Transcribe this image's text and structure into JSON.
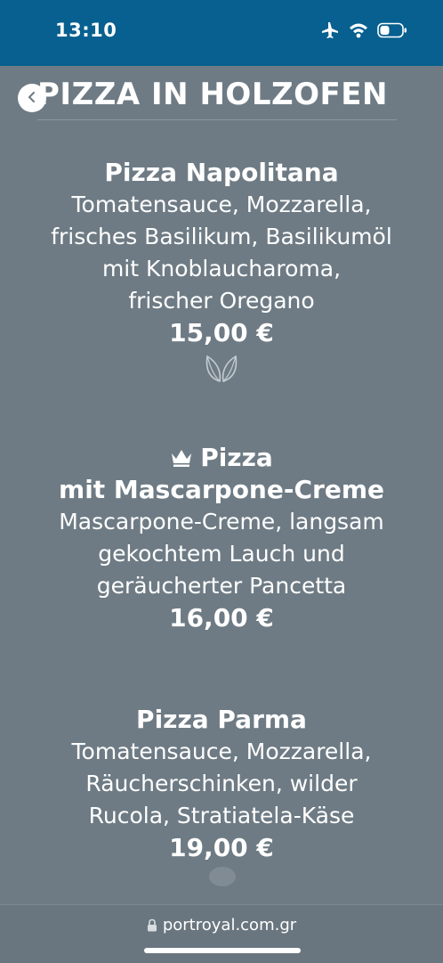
{
  "status_bar": {
    "time": "13:10",
    "icons": [
      "airplane-icon",
      "wifi-icon",
      "battery-icon"
    ]
  },
  "header": {
    "title": "PIZZA IN HOLZOFEN",
    "back_icon": "chevron-left-icon"
  },
  "menu": {
    "items": [
      {
        "name": "Pizza Napolitana",
        "description": [
          "Tomatensauce, Mozzarella,",
          "frisches Basilikum, Basilikumöl",
          "mit Knoblaucharoma,",
          "frischer Oregano"
        ],
        "price": "15,00 €",
        "icons": [
          "leaf-icon"
        ]
      },
      {
        "name_line1": "Pizza",
        "name_line2": "mit Mascarpone-Creme",
        "description": [
          "Mascarpone-Creme, langsam",
          "gekochtem Lauch und",
          "geräucherter Pancetta"
        ],
        "price": "16,00 €",
        "icons": [
          "crown-icon"
        ]
      },
      {
        "name": "Pizza Parma",
        "description": [
          "Tomatensauce, Mozzarella,",
          "Räucherschinken, wilder",
          "Rucola, Stratiatela-Käse"
        ],
        "price": "19,00 €"
      }
    ]
  },
  "browser": {
    "url": "portroyal.com.gr",
    "icons": [
      "lock-icon"
    ]
  },
  "colors": {
    "status_bar_bg": "#07608f",
    "page_bg": "#6e7b84",
    "text": "#ffffff"
  }
}
